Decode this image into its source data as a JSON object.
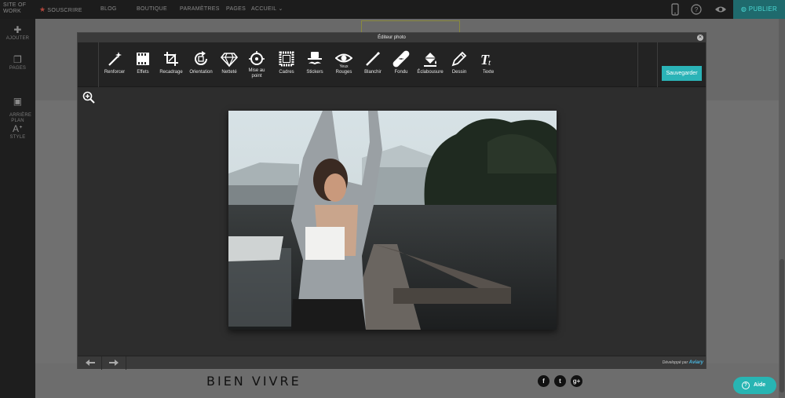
{
  "topbar": {
    "logo": "SITE OF\nWORK",
    "subscribe_label": "SOUSCRIRE",
    "nav_items": [
      "BLOG",
      "BOUTIQUE",
      "PARAMÈTRES"
    ],
    "pages_label": "PAGES",
    "current_page": "ACCUEIL",
    "publish_label": "PUBLIER",
    "icons": [
      "mobile-icon",
      "help-icon",
      "preview-eye-icon"
    ]
  },
  "sidebar": {
    "items": [
      {
        "label": "AJOUTER",
        "icon": "plus-icon"
      },
      {
        "label": "PAGES",
        "icon": "pages-icon"
      },
      {
        "label": "ARRIÈRE\nPLAN",
        "icon": "image-icon"
      },
      {
        "label": "STYLE",
        "icon": "style-icon"
      }
    ]
  },
  "editor": {
    "title": "Éditeur photo",
    "save_label": "Sauvegarder",
    "tools": [
      {
        "label": "Renforcer",
        "icon": "magic-wand-icon"
      },
      {
        "label": "Effets",
        "icon": "film-icon"
      },
      {
        "label": "Recadrage",
        "icon": "crop-icon"
      },
      {
        "label": "Orientation",
        "icon": "rotate-icon"
      },
      {
        "label": "Netteté",
        "icon": "diamond-icon"
      },
      {
        "label": "Mise au\npoint",
        "icon": "focus-icon"
      },
      {
        "label": "Cadres",
        "icon": "frame-icon"
      },
      {
        "label": "Stickers",
        "icon": "mustache-hat-icon"
      },
      {
        "label": "Rouges",
        "icon": "eye-icon",
        "sup": "Yeux"
      },
      {
        "label": "Blanchir",
        "icon": "pencil-line-icon"
      },
      {
        "label": "Fondu",
        "icon": "bandage-icon"
      },
      {
        "label": "Éclabousure",
        "icon": "paint-bucket-icon"
      },
      {
        "label": "Dessin",
        "icon": "pencil-icon"
      },
      {
        "label": "Texte",
        "icon": "text-icon"
      }
    ],
    "footer_credit_prefix": "Développé par",
    "footer_credit_brand": "Aviary"
  },
  "site": {
    "brand_bold": "BIEN",
    "brand_light": "VIVRE",
    "social": [
      "f",
      "t",
      "g+"
    ]
  },
  "help_label": "Aide",
  "colors": {
    "accent": "#2bb3b7",
    "publish_text": "#4ad8d3",
    "topbar_bg": "#1c1c1c"
  }
}
